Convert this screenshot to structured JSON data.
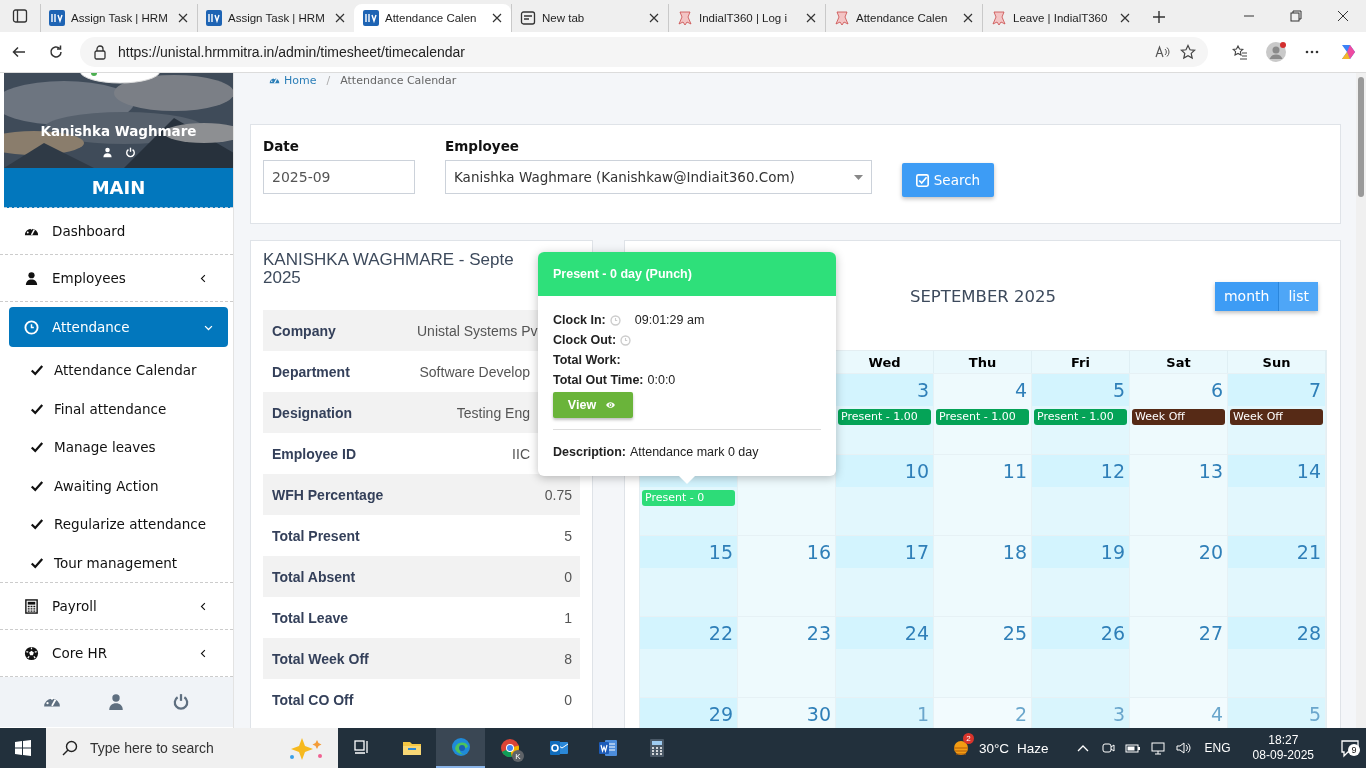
{
  "browser": {
    "tabs": [
      {
        "title": "Assign Task | HRM",
        "selected": false,
        "kind": "hrm"
      },
      {
        "title": "Assign Task | HRM",
        "selected": false,
        "kind": "hrm"
      },
      {
        "title": "Attendance Calen",
        "selected": true,
        "kind": "hrm"
      },
      {
        "title": "New tab",
        "selected": false,
        "kind": "newtab"
      },
      {
        "title": "IndialT360 | Log i",
        "selected": false,
        "kind": "ribbon"
      },
      {
        "title": "Attendance Calen",
        "selected": false,
        "kind": "ribbon"
      },
      {
        "title": "Leave | IndialT360",
        "selected": false,
        "kind": "ribbon"
      }
    ],
    "url": "https://unistal.hrmmitra.in/admin/timesheet/timecalendar"
  },
  "sidebar": {
    "user_name": "Kanishka Waghmare",
    "section_title": "MAIN",
    "menu": [
      {
        "label": "Dashboard",
        "selected": false
      },
      {
        "label": "Employees",
        "selected": false,
        "expanded": false
      },
      {
        "label": "Attendance",
        "selected": true,
        "expanded": true,
        "children": [
          {
            "label": "Attendance Calendar"
          },
          {
            "label": "Final attendance"
          },
          {
            "label": "Manage leaves"
          },
          {
            "label": "Awaiting Action"
          },
          {
            "label": "Regularize attendance"
          },
          {
            "label": "Tour management"
          }
        ]
      },
      {
        "label": "Payroll",
        "selected": false,
        "expanded": false
      },
      {
        "label": "Core HR",
        "selected": false,
        "expanded": false
      }
    ]
  },
  "breadcrumb": {
    "items": [
      "Home",
      "Attendance Calendar"
    ],
    "separator": "/"
  },
  "filter": {
    "date_label": "Date",
    "date_value": "2025-09",
    "employee_label": "Employee",
    "employee_value": "Kanishka Waghmare (Kanishkaw@Indiait360.Com)",
    "search_button": "Search"
  },
  "summary": {
    "title_lines": [
      "KANISHKA WAGHMARE - Septe",
      "2025"
    ],
    "rows": [
      {
        "label": "Company",
        "value": "Unistal Systems Pv",
        "covered": true
      },
      {
        "label": "Department",
        "value": "Software Develop",
        "covered": true
      },
      {
        "label": "Designation",
        "value": "Testing Eng",
        "covered": true
      },
      {
        "label": "Employee ID",
        "value": "IIC",
        "covered": true
      },
      {
        "label": "WFH Percentage",
        "value": "0.75",
        "covered": false
      },
      {
        "label": "Total Present",
        "value": "5",
        "covered": false
      },
      {
        "label": "Total Absent",
        "value": "0",
        "covered": false
      },
      {
        "label": "Total Leave",
        "value": "1",
        "covered": false
      },
      {
        "label": "Total Week Off",
        "value": "8",
        "covered": false
      },
      {
        "label": "Total CO Off",
        "value": "0",
        "covered": false
      }
    ]
  },
  "calendar": {
    "title": "SEPTEMBER 2025",
    "views": [
      {
        "label": "month",
        "selected": true
      },
      {
        "label": "list",
        "selected": false
      }
    ],
    "weekdays": [
      "Wed",
      "Thu",
      "Fri",
      "Sat",
      "Sun"
    ],
    "weeks": [
      {
        "days": [
          {
            "day": "3",
            "other_month": false,
            "events": [
              {
                "title": "Present - 1.00",
                "color": "#05a357"
              }
            ]
          },
          {
            "day": "4",
            "other_month": false,
            "events": [
              {
                "title": "Present - 1.00",
                "color": "#05a357"
              }
            ]
          },
          {
            "day": "5",
            "other_month": false,
            "events": [
              {
                "title": "Present - 1.00",
                "color": "#05a357"
              }
            ]
          },
          {
            "day": "6",
            "other_month": false,
            "events": [
              {
                "title": "Week Off",
                "color": "#562a16"
              }
            ]
          },
          {
            "day": "7",
            "other_month": false,
            "events": [
              {
                "title": "Week Off",
                "color": "#562a16"
              }
            ]
          }
        ]
      },
      {
        "days": [
          {
            "events": [
              {
                "title": "Present - 0",
                "color": "#2ddc78"
              }
            ]
          },
          {
            "day": "10",
            "other_month": false
          },
          {
            "day": "11",
            "other_month": false
          },
          {
            "day": "12",
            "other_month": false
          },
          {
            "day": "13",
            "other_month": false
          },
          {
            "day": "14",
            "other_month": false
          }
        ]
      },
      {
        "days": [
          {
            "day": "15",
            "other_month": false
          },
          {
            "day": "16",
            "other_month": false
          },
          {
            "day": "17",
            "other_month": false
          },
          {
            "day": "18",
            "other_month": false
          },
          {
            "day": "19",
            "other_month": false
          },
          {
            "day": "20",
            "other_month": false
          },
          {
            "day": "21",
            "other_month": false
          }
        ]
      },
      {
        "days": [
          {
            "day": "22",
            "other_month": false
          },
          {
            "day": "23",
            "other_month": false
          },
          {
            "day": "24",
            "other_month": false
          },
          {
            "day": "25",
            "other_month": false
          },
          {
            "day": "26",
            "other_month": false
          },
          {
            "day": "27",
            "other_month": false
          },
          {
            "day": "28",
            "other_month": false
          }
        ]
      },
      {
        "days": [
          {
            "day": "29",
            "other_month": false
          },
          {
            "day": "30",
            "other_month": false
          },
          {
            "day": "1",
            "other_month": true
          },
          {
            "day": "2",
            "other_month": true
          },
          {
            "day": "3",
            "other_month": true
          },
          {
            "day": "4",
            "other_month": true
          },
          {
            "day": "5",
            "other_month": true
          }
        ]
      }
    ]
  },
  "popover": {
    "title": "Present - 0 day (Punch)",
    "fields": [
      {
        "label": "Clock In:",
        "value": "09:01:29 am",
        "kind": "time"
      },
      {
        "label": "Clock Out:",
        "kind": "time"
      },
      {
        "label": "Total Work:",
        "kind": "text"
      },
      {
        "label": "Total Out Time:",
        "value": "0:0:0",
        "kind": "text"
      }
    ],
    "button": "View",
    "description_label": "Description:",
    "description": "Attendance mark 0 day"
  },
  "taskbar": {
    "search_placeholder": "Type here to search",
    "chrome_profile": "K",
    "weather_badge": "2",
    "temperature": "30°C",
    "weather": "Haze",
    "language": "ENG",
    "time": "18:27",
    "date": "08-09-2025",
    "notifications": "9"
  }
}
